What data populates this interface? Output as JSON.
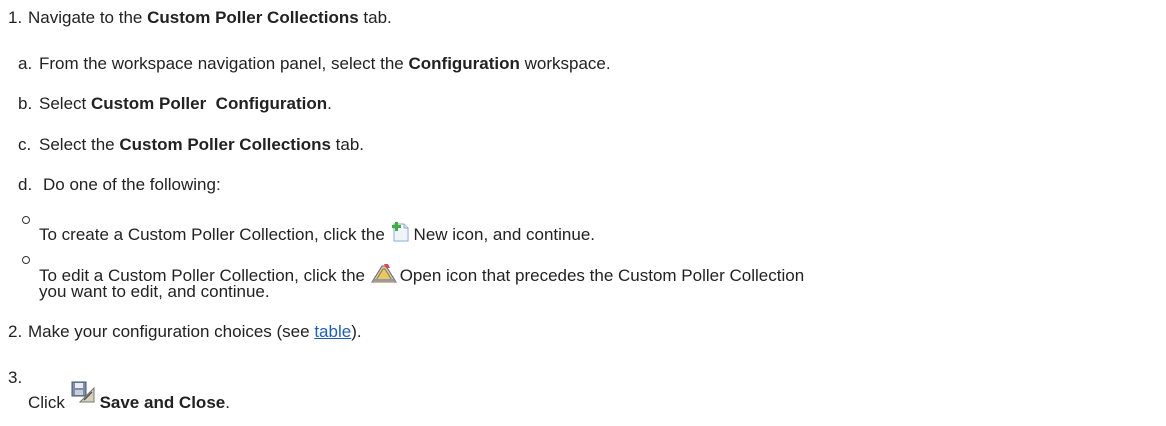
{
  "steps": {
    "step1": {
      "marker": "1.",
      "pre": "Navigate to the ",
      "bold": "Custom Poller Collections",
      "post": " tab."
    },
    "step1a": {
      "marker": "a.",
      "pre": "From the workspace navigation panel, select the ",
      "bold": "Configuration",
      "post": " workspace."
    },
    "step1b": {
      "marker": "b.",
      "pre": "Select ",
      "bold": "Custom Poller  Configuration",
      "post": "."
    },
    "step1c": {
      "marker": "c.",
      "pre": "Select the ",
      "bold": "Custom Poller Collections",
      "post": " tab."
    },
    "step1d": {
      "marker": "d.",
      "text": "Do one of the following:"
    },
    "sub1": {
      "pre": "To create a Custom Poller Collection, click the ",
      "post": "New icon, and continue."
    },
    "sub2": {
      "pre": "To edit a Custom Poller Collection, click the ",
      "post": "Open icon that precedes the Custom Poller Collection",
      "cont": "you want to edit, and continue."
    },
    "step2": {
      "marker": "2.",
      "pre": "Make your configuration choices (see ",
      "link": "table",
      "post": ")."
    },
    "step3": {
      "marker": "3.",
      "pre": "Click ",
      "bold": "Save and Close",
      "post": "."
    }
  },
  "icons": {
    "new": "new-document-icon",
    "open": "open-folder-icon",
    "save": "save-and-close-icon"
  },
  "colors": {
    "text": "#222222",
    "link": "#2060b0"
  }
}
